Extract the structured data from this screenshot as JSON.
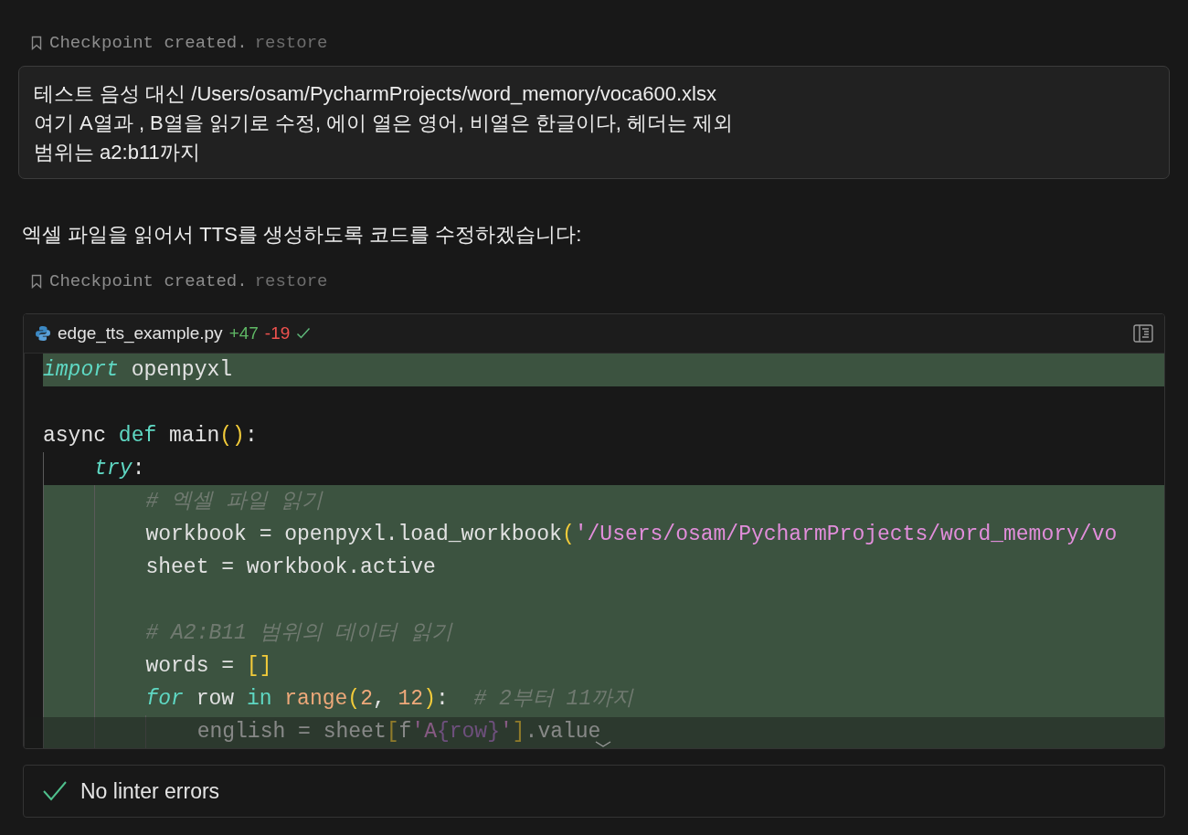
{
  "checkpoints": [
    {
      "text": "Checkpoint created.",
      "action": "restore"
    },
    {
      "text": "Checkpoint created.",
      "action": "restore"
    }
  ],
  "user_message": {
    "lines": [
      "테스트 음성 대신 /Users/osam/PycharmProjects/word_memory/voca600.xlsx",
      "여기 A열과 , B열을 읽기로 수정, 에이 열은 영어, 비열은 한글이다, 헤더는 제외",
      "범위는 a2:b11까지"
    ]
  },
  "assistant_message": "엑셀 파일을 읽어서 TTS를 생성하도록 코드를 수정하겠습니다:",
  "code_block": {
    "filename": "edge_tts_example.py",
    "additions": "+47",
    "deletions": "-19",
    "applied": true,
    "lines": [
      {
        "added": true,
        "tokens": [
          {
            "t": "import",
            "kind": "keyword_italic"
          },
          {
            "t": " openpyxl",
            "kind": "plain"
          }
        ]
      },
      {
        "added": false
      },
      {
        "added": false,
        "tokens": [
          {
            "t": "async ",
            "kind": "plain"
          },
          {
            "t": "def",
            "kind": "keyword"
          },
          {
            "t": " main",
            "kind": "plain"
          },
          {
            "t": "()",
            "kind": "bracket"
          },
          {
            "t": ":",
            "kind": "plain"
          }
        ],
        "children": [
          {
            "added": false,
            "tokens": [
              {
                "t": "try",
                "kind": "keyword_italic"
              },
              {
                "t": ":",
                "kind": "plain"
              }
            ],
            "children": [
              {
                "added": true,
                "tokens": [
                  {
                    "t": "# 엑셀 파일 읽기",
                    "kind": "comment"
                  }
                ]
              },
              {
                "added": true,
                "tokens": [
                  {
                    "t": "workbook = openpyxl.load_workbook",
                    "kind": "plain"
                  },
                  {
                    "t": "(",
                    "kind": "bracket"
                  },
                  {
                    "t": "'/Users/osam/PycharmProjects/word_memory/vo",
                    "kind": "string"
                  }
                ]
              },
              {
                "added": true,
                "tokens": [
                  {
                    "t": "sheet = workbook.active",
                    "kind": "plain"
                  }
                ]
              },
              {
                "added": true
              },
              {
                "added": true,
                "tokens": [
                  {
                    "t": "# A2:B11 범위의 데이터 읽기",
                    "kind": "comment"
                  }
                ]
              },
              {
                "added": true,
                "tokens": [
                  {
                    "t": "words = ",
                    "kind": "plain"
                  },
                  {
                    "t": "[]",
                    "kind": "bracket"
                  }
                ]
              },
              {
                "added": true,
                "tokens": [
                  {
                    "t": "for",
                    "kind": "keyword_italic"
                  },
                  {
                    "t": " row ",
                    "kind": "plain"
                  },
                  {
                    "t": "in",
                    "kind": "keyword"
                  },
                  {
                    "t": " range",
                    "kind": "builtin"
                  },
                  {
                    "t": "(",
                    "kind": "bracket"
                  },
                  {
                    "t": "2",
                    "kind": "number"
                  },
                  {
                    "t": ", ",
                    "kind": "plain"
                  },
                  {
                    "t": "12",
                    "kind": "number"
                  },
                  {
                    "t": ")",
                    "kind": "bracket"
                  },
                  {
                    "t": ":  ",
                    "kind": "plain"
                  },
                  {
                    "t": "# 2부터 11까지",
                    "kind": "comment"
                  }
                ],
                "children": [
                  {
                    "added": true,
                    "tokens": [
                      {
                        "t": "english = sheet",
                        "kind": "plain"
                      },
                      {
                        "t": "[",
                        "kind": "bracket"
                      },
                      {
                        "t": "f",
                        "kind": "plain"
                      },
                      {
                        "t": "'A",
                        "kind": "string"
                      },
                      {
                        "t": "{row}",
                        "kind": "interp"
                      },
                      {
                        "t": "'",
                        "kind": "string"
                      },
                      {
                        "t": "]",
                        "kind": "bracket"
                      },
                      {
                        "t": ".value",
                        "kind": "plain"
                      }
                    ]
                  }
                ]
              }
            ]
          }
        ]
      }
    ],
    "collapsed": true
  },
  "linter": {
    "text": "No linter errors",
    "ok": true
  }
}
